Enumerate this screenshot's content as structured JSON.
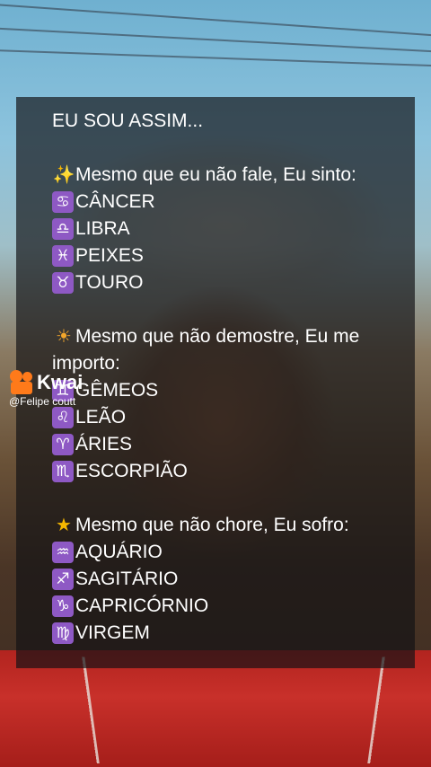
{
  "title": "EU SOU ASSIM...",
  "sections": [
    {
      "emoji": "✨",
      "emoji_name": "sparkles-icon",
      "heading": "Mesmo que eu não fale, Eu sinto:",
      "signs": [
        {
          "symbol": "♋",
          "icon": "cancer-icon",
          "label": "CÂNCER"
        },
        {
          "symbol": "♎",
          "icon": "libra-icon",
          "label": "LIBRA"
        },
        {
          "symbol": "♓",
          "icon": "pisces-icon",
          "label": "PEIXES"
        },
        {
          "symbol": "♉",
          "icon": "taurus-icon",
          "label": "TOURO"
        }
      ]
    },
    {
      "emoji": "☀",
      "emoji_name": "sun-icon",
      "heading": "Mesmo que não demostre, Eu me importo:",
      "signs": [
        {
          "symbol": "♊",
          "icon": "gemini-icon",
          "label": "GÊMEOS"
        },
        {
          "symbol": "♌",
          "icon": "leo-icon",
          "label": "LEÃO"
        },
        {
          "symbol": "♈",
          "icon": "aries-icon",
          "label": "ÁRIES"
        },
        {
          "symbol": "♏",
          "icon": "scorpio-icon",
          "label": "ESCORPIÃO"
        }
      ]
    },
    {
      "emoji": "★",
      "emoji_name": "star-icon",
      "heading": "Mesmo que não chore, Eu sofro:",
      "signs": [
        {
          "symbol": "♒",
          "icon": "aquarius-icon",
          "label": "AQUÁRIO"
        },
        {
          "symbol": "♐",
          "icon": "sagittarius-icon",
          "label": "SAGITÁRIO"
        },
        {
          "symbol": "♑",
          "icon": "capricorn-icon",
          "label": "CAPRICÓRNIO"
        },
        {
          "symbol": "♍",
          "icon": "virgo-icon",
          "label": "VIRGEM"
        }
      ]
    }
  ],
  "watermark": {
    "brand": "Kwai",
    "user": "@Felipe coutt"
  },
  "colors": {
    "sign_badge": "#8e59c4",
    "kwai_orange": "#ff7a1a"
  }
}
